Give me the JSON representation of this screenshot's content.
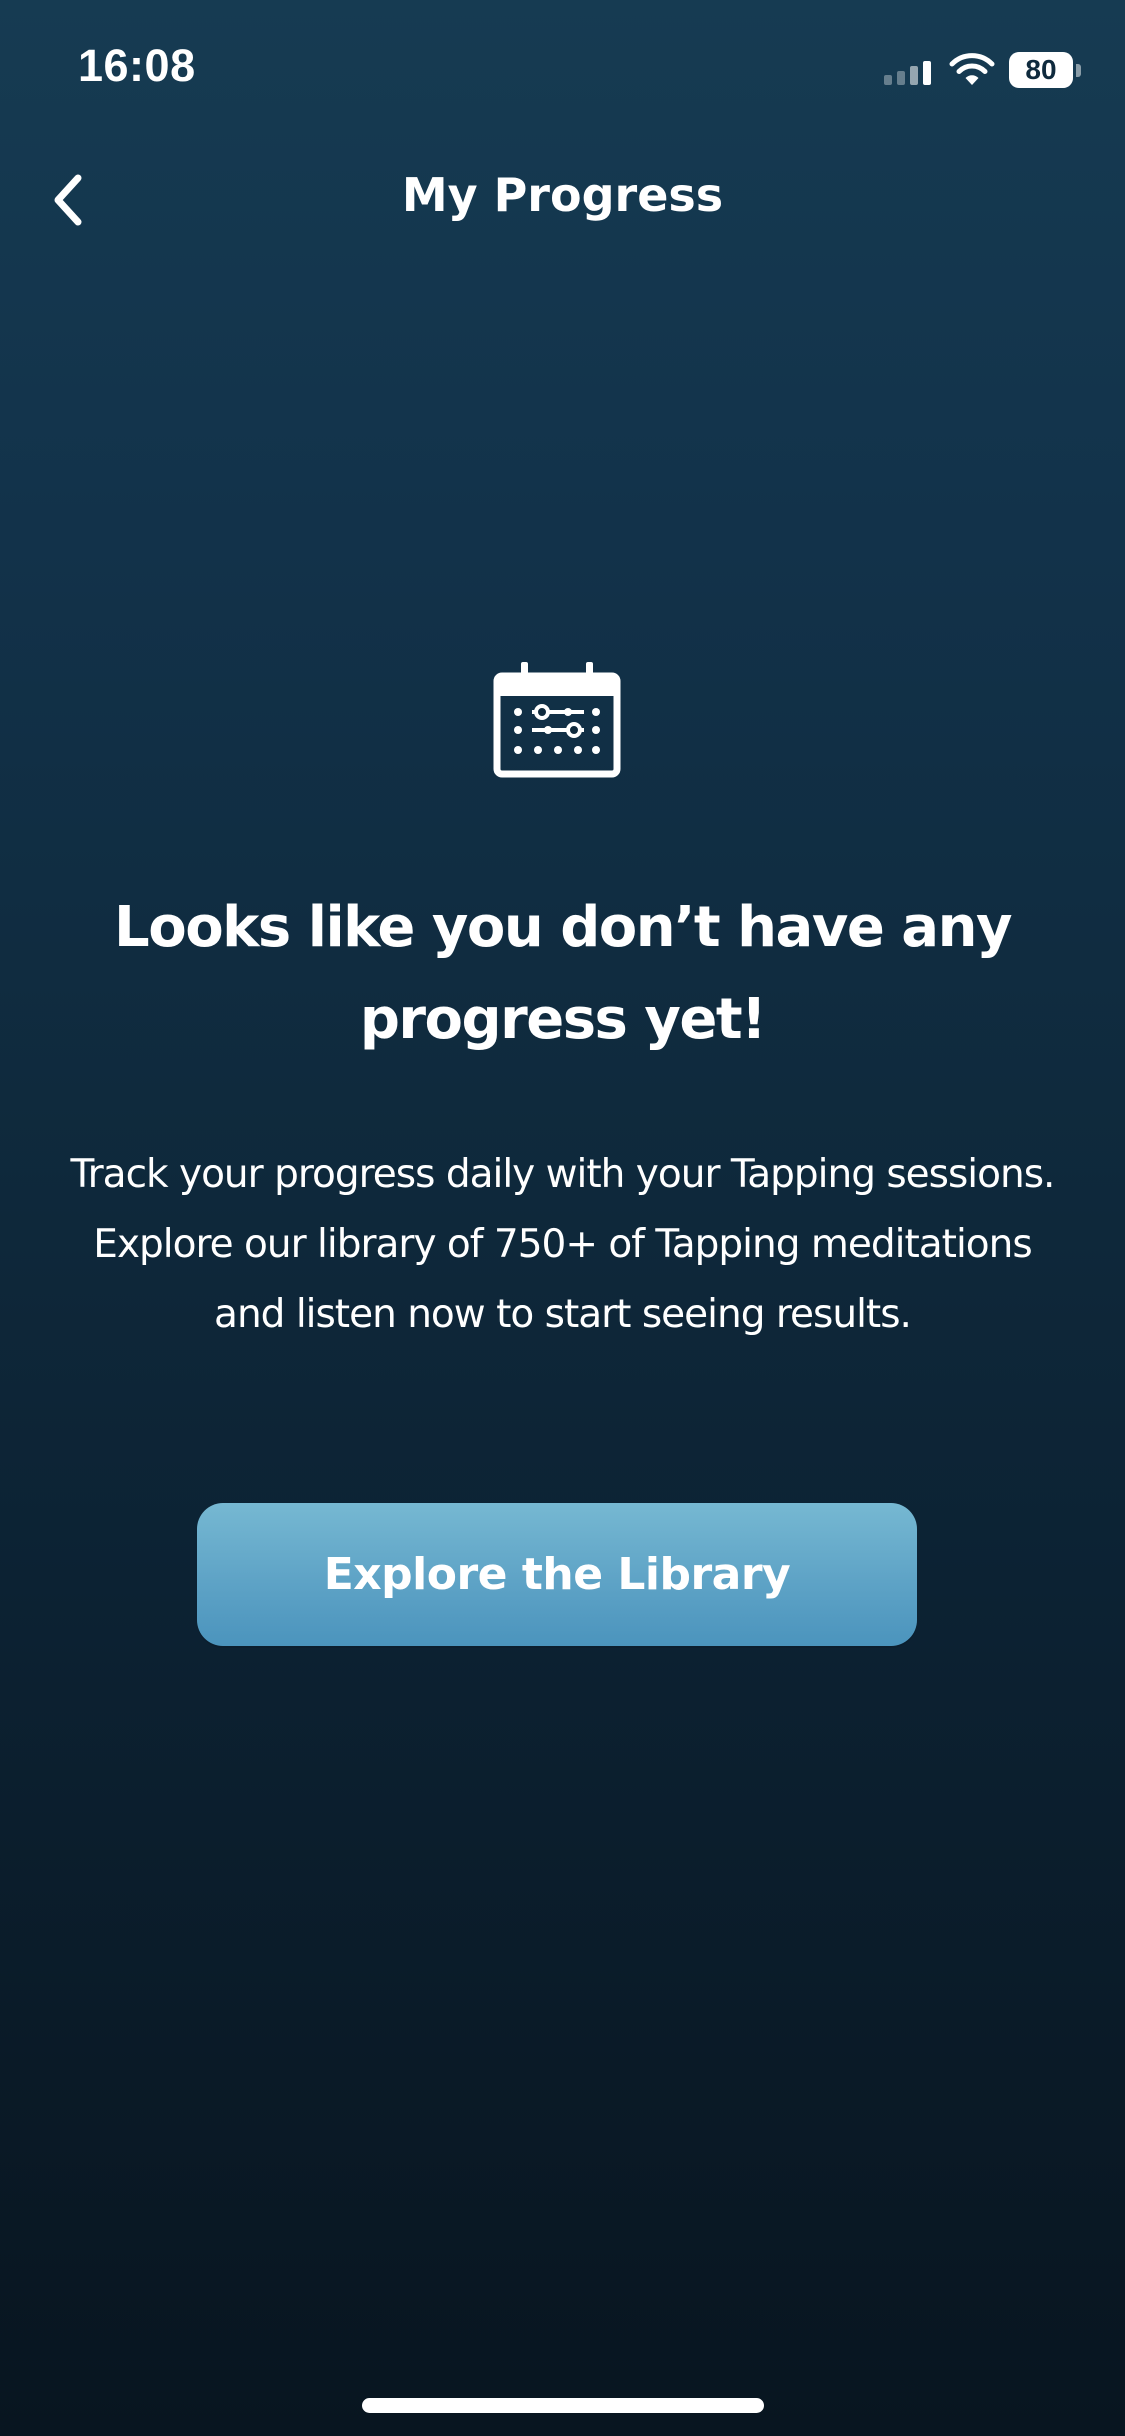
{
  "status_bar": {
    "time": "16:08",
    "battery": "80",
    "battery_level": 0.8,
    "icons": [
      "cellular-signal-icon",
      "wifi-icon",
      "battery-icon"
    ]
  },
  "nav": {
    "title": "My Progress",
    "back_icon": "chevron-left-icon"
  },
  "empty_state": {
    "icon": "calendar-icon",
    "heading": "Looks like you don’t have any progress yet!",
    "body": "Track your progress daily with your Tapping sessions. Explore our library of 750+ of Tapping meditations and listen now to start seeing results.",
    "button_label": "Explore the Library"
  },
  "colors": {
    "background_top": "#163b52",
    "background_bottom": "#081520",
    "button_top": "#76b8d2",
    "button_bottom": "#4b94bd",
    "text": "#ffffff"
  }
}
